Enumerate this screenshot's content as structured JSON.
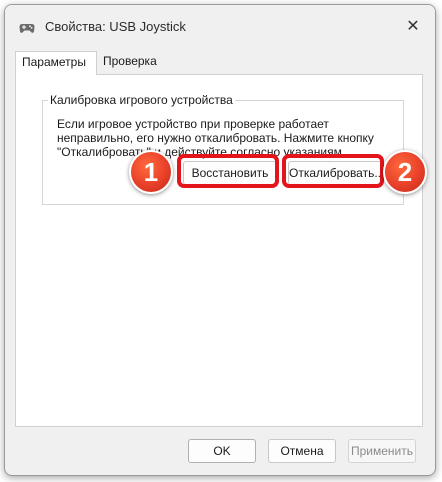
{
  "window": {
    "title": "Свойства: USB Joystick",
    "close_glyph": "✕"
  },
  "tabs": [
    {
      "label": "Параметры",
      "active": true
    },
    {
      "label": "Проверка",
      "active": false
    }
  ],
  "calibration": {
    "group_title": "Калибровка игрового устройства",
    "description": "Если игровое устройство при проверке работает неправильно, его нужно откалибровать. Нажмите кнопку \"Откалибровать\" и действуйте согласно указаниям.",
    "restore_label": "Восстановить",
    "calibrate_label": "Откалибровать..."
  },
  "annotations": {
    "marker_1": "1",
    "marker_2": "2",
    "highlight_color": "#e4141b"
  },
  "footer": {
    "ok_label": "OK",
    "cancel_label": "Отмена",
    "apply_label": "Применить"
  },
  "icons": {
    "title_icon": "gamepad-icon"
  }
}
